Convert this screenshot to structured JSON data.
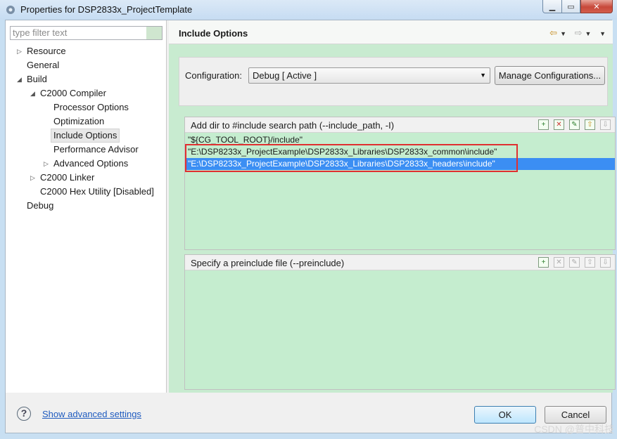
{
  "window": {
    "title": "Properties for DSP2833x_ProjectTemplate"
  },
  "left": {
    "filter_placeholder": "type filter text",
    "tree": [
      {
        "label": "Resource",
        "level": 0,
        "arrow": "▷"
      },
      {
        "label": "General",
        "level": 0,
        "arrow": ""
      },
      {
        "label": "Build",
        "level": 0,
        "arrow": "◢"
      },
      {
        "label": "C2000 Compiler",
        "level": 1,
        "arrow": "◢"
      },
      {
        "label": "Processor Options",
        "level": 2,
        "arrow": ""
      },
      {
        "label": "Optimization",
        "level": 2,
        "arrow": ""
      },
      {
        "label": "Include Options",
        "level": 2,
        "arrow": "",
        "selected": true
      },
      {
        "label": "Performance Advisor",
        "level": 2,
        "arrow": ""
      },
      {
        "label": "Advanced Options",
        "level": 2,
        "arrow": "▷"
      },
      {
        "label": "C2000 Linker",
        "level": 1,
        "arrow": "▷"
      },
      {
        "label": "C2000 Hex Utility  [Disabled]",
        "level": 1,
        "arrow": ""
      },
      {
        "label": "Debug",
        "level": 0,
        "arrow": ""
      }
    ]
  },
  "right": {
    "page_title": "Include Options",
    "configuration_label": "Configuration:",
    "configuration_value": "Debug  [ Active ]",
    "manage_button": "Manage Configurations...",
    "include_group": {
      "title": "Add dir to #include search path (--include_path, -I)",
      "items": [
        "\"${CG_TOOL_ROOT}/include\"",
        "\"E:\\DSP8233x_ProjectExample\\DSP2833x_Libraries\\DSP2833x_common\\include\"",
        "\"E:\\DSP8233x_ProjectExample\\DSP2833x_Libraries\\DSP2833x_headers\\include\""
      ],
      "selected_index": 2
    },
    "preinclude_group": {
      "title": "Specify a preinclude file (--preinclude)",
      "items": []
    }
  },
  "footer": {
    "help_icon": "?",
    "advanced_link": "Show advanced settings",
    "ok": "OK",
    "cancel": "Cancel"
  },
  "watermark": "CSDN @普中科技"
}
